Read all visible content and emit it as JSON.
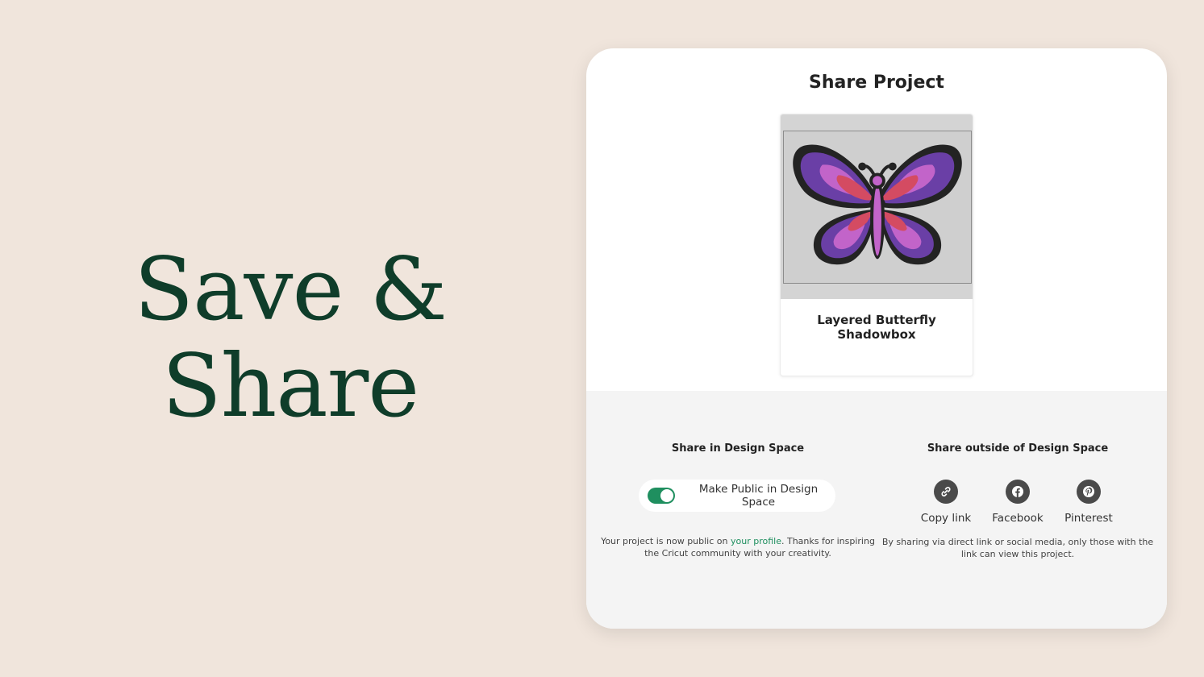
{
  "hero": {
    "line1": "Save &",
    "line2": "Share"
  },
  "dialog": {
    "title": "Share Project",
    "project": {
      "name": "Layered Butterfly Shadowbox"
    },
    "share_in": {
      "heading": "Share in Design Space",
      "toggle_label": "Make Public in Design Space",
      "toggle_on": true,
      "note_before": "Your project is now public on ",
      "note_link": "your profile",
      "note_after": ". Thanks for inspiring the Cricut community with your creativity."
    },
    "share_out": {
      "heading": "Share outside of Design Space",
      "buttons": [
        {
          "label": "Copy link",
          "icon": "link-icon"
        },
        {
          "label": "Facebook",
          "icon": "facebook-icon"
        },
        {
          "label": "Pinterest",
          "icon": "pinterest-icon"
        }
      ],
      "note": "By sharing via direct link or social media, only those with the link can view this project."
    }
  },
  "colors": {
    "background": "#f0e5dc",
    "hero_text": "#0f3d2a",
    "accent_green": "#1f8f5f",
    "share_area": "#f4f4f4"
  }
}
